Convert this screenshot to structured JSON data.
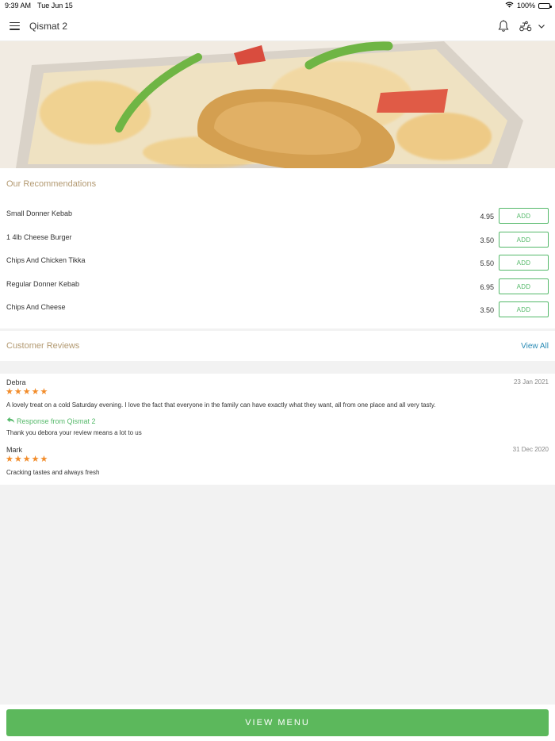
{
  "status_bar": {
    "time": "9:39 AM",
    "date": "Tue Jun 15",
    "battery": "100%"
  },
  "header": {
    "title": "Qismat 2"
  },
  "recommendations": {
    "title": "Our Recommendations",
    "items": [
      {
        "name": "Small Donner Kebab",
        "price": "4.95",
        "button": "ADD"
      },
      {
        "name": "1 4lb Cheese Burger",
        "price": "3.50",
        "button": "ADD"
      },
      {
        "name": "Chips And Chicken Tikka",
        "price": "5.50",
        "button": "ADD"
      },
      {
        "name": "Regular Donner Kebab",
        "price": "6.95",
        "button": "ADD"
      },
      {
        "name": "Chips And Cheese",
        "price": "3.50",
        "button": "ADD"
      }
    ]
  },
  "reviews": {
    "title": "Customer Reviews",
    "view_all": "View All",
    "items": [
      {
        "name": "Debra",
        "date": "23 Jan 2021",
        "rating": 5,
        "text": "A lovely treat on a cold Saturday evening. I love the fact that everyone in the family can have exactly what they want, all from one place and all very tasty.",
        "response_label": "Response from Qismat 2",
        "response_text": "Thank you debora your review means a lot to us"
      },
      {
        "name": "Mark",
        "date": "31 Dec 2020",
        "rating": 5,
        "text": "Cracking tastes and always fresh"
      }
    ]
  },
  "footer": {
    "button": "VIEW MENU"
  },
  "colors": {
    "accent_green": "#5cb85c",
    "star_orange": "#f28c2a",
    "section_title": "#b39a72",
    "link_blue": "#2a8bb5"
  }
}
